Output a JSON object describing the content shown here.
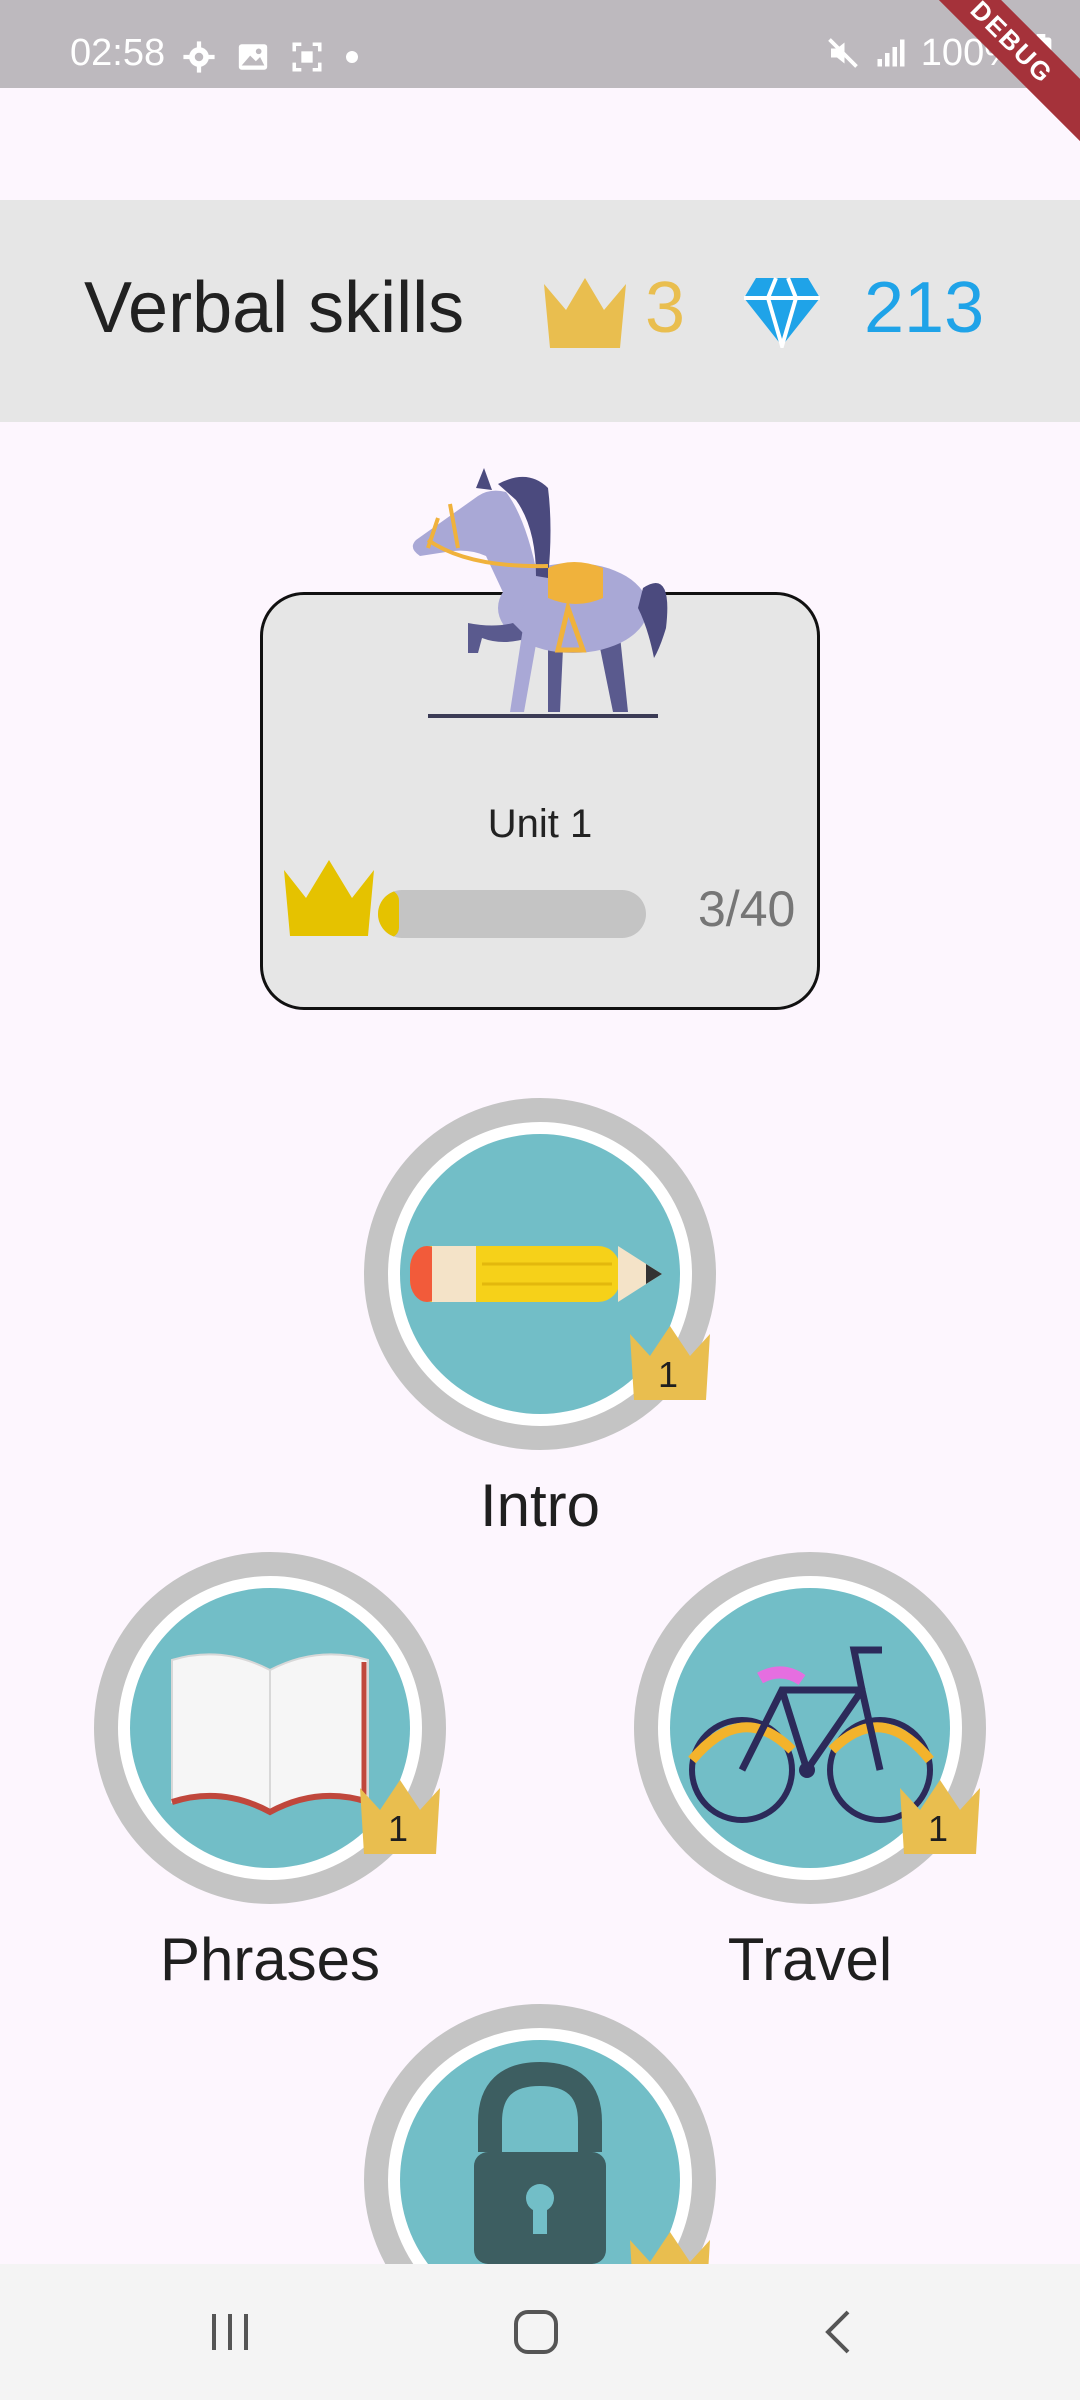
{
  "status_bar": {
    "time": "02:58",
    "battery": "100%",
    "debug": "DEBUG",
    "icons": [
      "gear-icon",
      "image-icon",
      "screenshot-icon",
      "dot-icon",
      "mute-icon",
      "signal-icon",
      "battery-icon"
    ]
  },
  "header": {
    "title": "Verbal skills",
    "crowns": "3",
    "gems": "213",
    "colors": {
      "crown": "#e9be4f",
      "gem": "#1fa3e8"
    }
  },
  "unit": {
    "title": "Unit 1",
    "progress_text": "3/40",
    "progress_fraction": 0.075,
    "colors": {
      "crown": "#e5c200",
      "track": "#c4c4c4"
    }
  },
  "skills": [
    {
      "label": "Intro",
      "crown_level": "1",
      "icon": "pencil-icon",
      "locked": false
    },
    {
      "label": "Phrases",
      "crown_level": "1",
      "icon": "book-icon",
      "locked": false
    },
    {
      "label": "Travel",
      "crown_level": "1",
      "icon": "bicycle-icon",
      "locked": false
    },
    {
      "label": "",
      "crown_level": "",
      "icon": "lock-icon",
      "locked": true
    }
  ],
  "nav": {
    "icons": [
      "recent-apps-icon",
      "home-icon",
      "back-icon"
    ]
  }
}
